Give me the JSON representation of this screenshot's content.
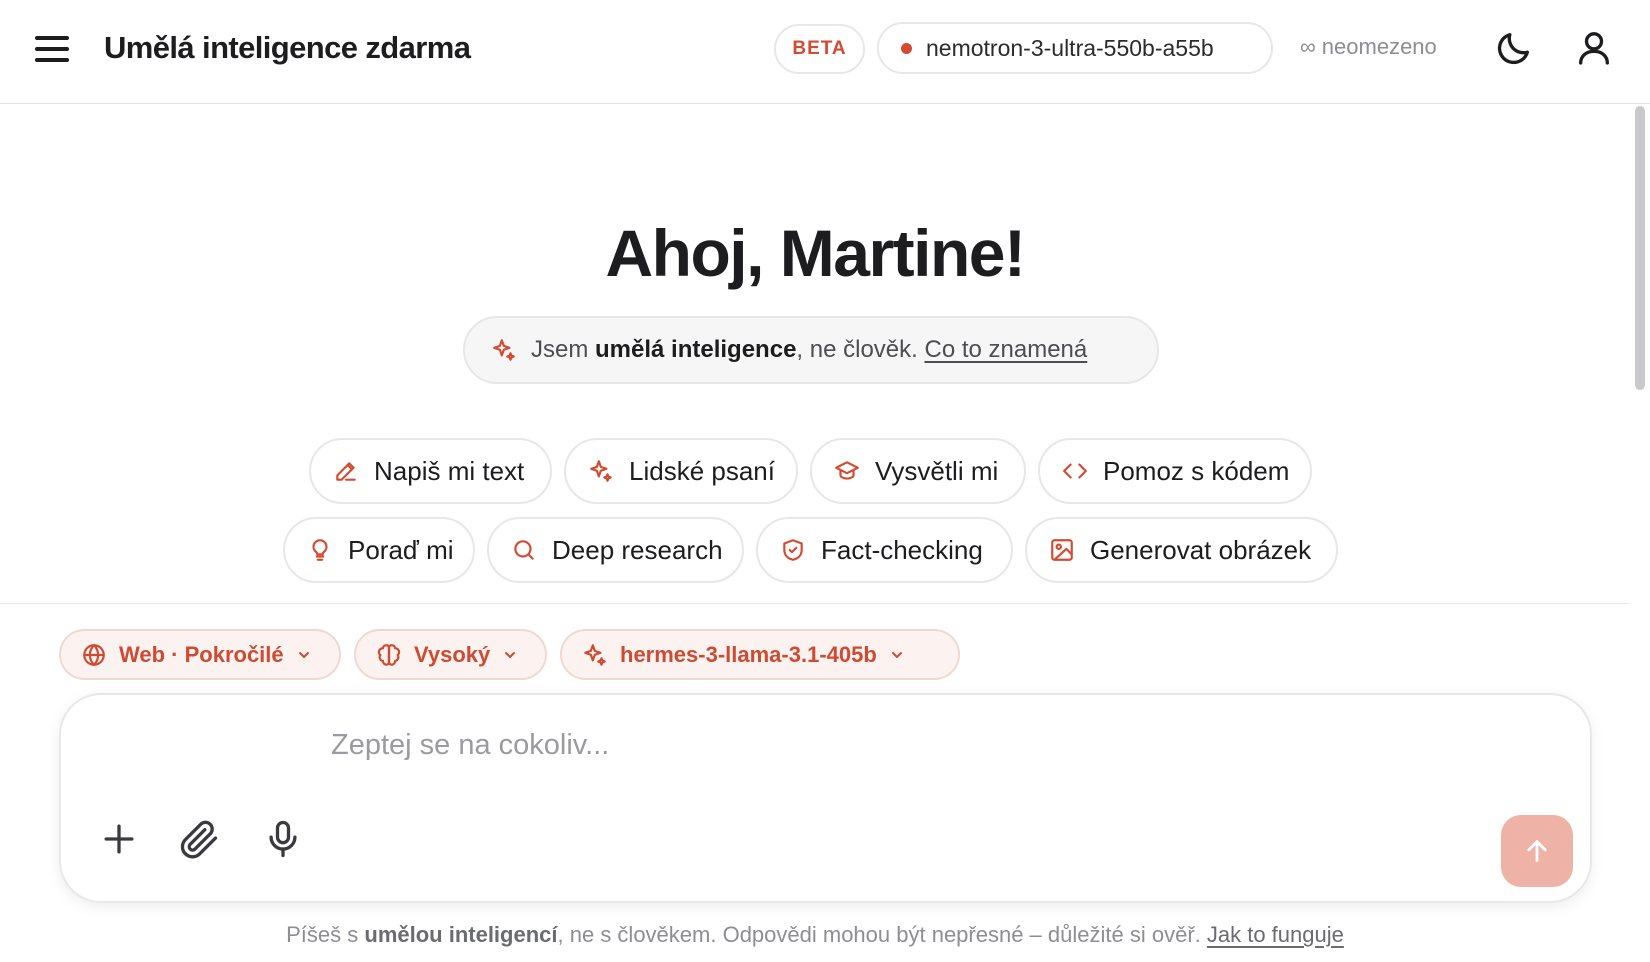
{
  "header": {
    "title": "Umělá inteligence zdarma",
    "beta_label": "BETA",
    "model_name": "nemotron-3-ultra-550b-a55b",
    "limit_text": "∞ neomezeno"
  },
  "greeting": "Ahoj, Martine!",
  "notice": {
    "prefix": "Jsem ",
    "bold": "umělá inteligence",
    "suffix": ", ne člověk. ",
    "link": "Co to znamená"
  },
  "suggestions": [
    {
      "label": "Napiš mi text",
      "icon": "pencil-icon"
    },
    {
      "label": "Lidské psaní",
      "icon": "sparkle-icon"
    },
    {
      "label": "Vysvětli mi",
      "icon": "graduation-cap-icon"
    },
    {
      "label": "Pomoz s kódem",
      "icon": "code-icon"
    },
    {
      "label": "Poraď mi",
      "icon": "lightbulb-icon"
    },
    {
      "label": "Deep research",
      "icon": "search-icon"
    },
    {
      "label": "Fact-checking",
      "icon": "shield-check-icon"
    },
    {
      "label": "Generovat obrázek",
      "icon": "image-icon"
    }
  ],
  "options": {
    "search_mode": "Web · Pokročilé",
    "reasoning_level": "Vysoký",
    "model": "hermes-3-llama-3.1-405b"
  },
  "composer": {
    "placeholder": "Zeptej se na cokoliv..."
  },
  "disclaimer": {
    "prefix": "Píšeš s ",
    "bold": "umělou inteligencí",
    "suffix": ", ne s člověkem. Odpovědi mohou být nepřesné – důležité si ověř. ",
    "link": "Jak to funguje"
  },
  "colors": {
    "accent": "#d24b33",
    "send_button": "#eeb2a6",
    "pill_background": "#fcf3f1"
  }
}
